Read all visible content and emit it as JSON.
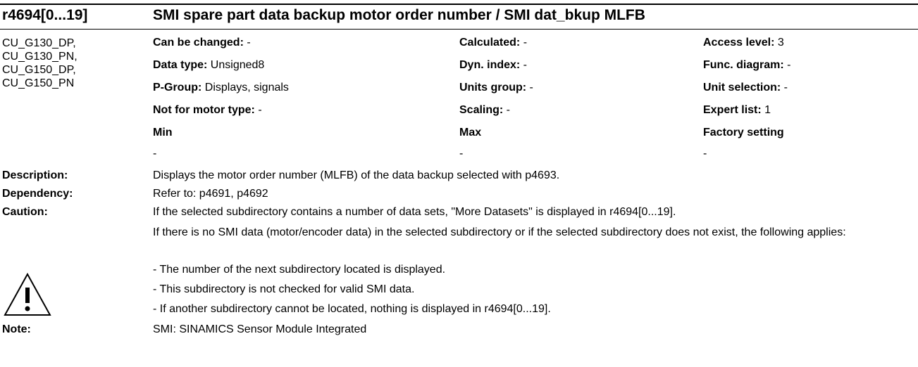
{
  "header": {
    "param_id": "r4694[0...19]",
    "title": "SMI spare part data backup motor order number / SMI dat_bkup MLFB"
  },
  "control_units": [
    "CU_G130_DP,",
    "CU_G130_PN,",
    "CU_G150_DP,",
    "CU_G150_PN"
  ],
  "attributes": {
    "can_be_changed": {
      "label": "Can be changed:",
      "value": " -"
    },
    "calculated": {
      "label": "Calculated:",
      "value": " -"
    },
    "access_level": {
      "label": "Access level:",
      "value": " 3"
    },
    "data_type": {
      "label": "Data type:",
      "value": " Unsigned8"
    },
    "dyn_index": {
      "label": "Dyn. index:",
      "value": " -"
    },
    "func_diagram": {
      "label": "Func. diagram:",
      "value": " -"
    },
    "p_group": {
      "label": "P-Group:",
      "value": " Displays, signals"
    },
    "units_group": {
      "label": "Units group:",
      "value": " -"
    },
    "unit_selection": {
      "label": "Unit selection:",
      "value": " -"
    },
    "not_for_motor_type": {
      "label": "Not for motor type:",
      "value": " -"
    },
    "scaling": {
      "label": "Scaling:",
      "value": " -"
    },
    "expert_list": {
      "label": "Expert list:",
      "value": " 1"
    }
  },
  "limits": {
    "min_label": "Min",
    "min_value": "-",
    "max_label": "Max",
    "max_value": "-",
    "factory_label": "Factory setting",
    "factory_value": "-"
  },
  "description": {
    "label": "Description:",
    "text": "Displays the motor order number (MLFB) of the data backup selected with p4693."
  },
  "dependency": {
    "label": "Dependency:",
    "text": "Refer to: p4691, p4692"
  },
  "caution": {
    "label": "Caution:",
    "icon": "warning-triangle-icon",
    "line1": "If the selected subdirectory contains a number of data sets, \"More Datasets\" is displayed in r4694[0...19].",
    "line2": "If there is no SMI data (motor/encoder data) in the selected subdirectory or if the selected subdirectory does not exist, the following applies:",
    "bullet1": "- The number of the next subdirectory located is displayed.",
    "bullet2": "- This subdirectory is not checked for valid SMI data.",
    "bullet3": "- If another subdirectory cannot be located, nothing is displayed in r4694[0...19]."
  },
  "note": {
    "label": "Note:",
    "text": "SMI: SINAMICS Sensor Module Integrated"
  }
}
